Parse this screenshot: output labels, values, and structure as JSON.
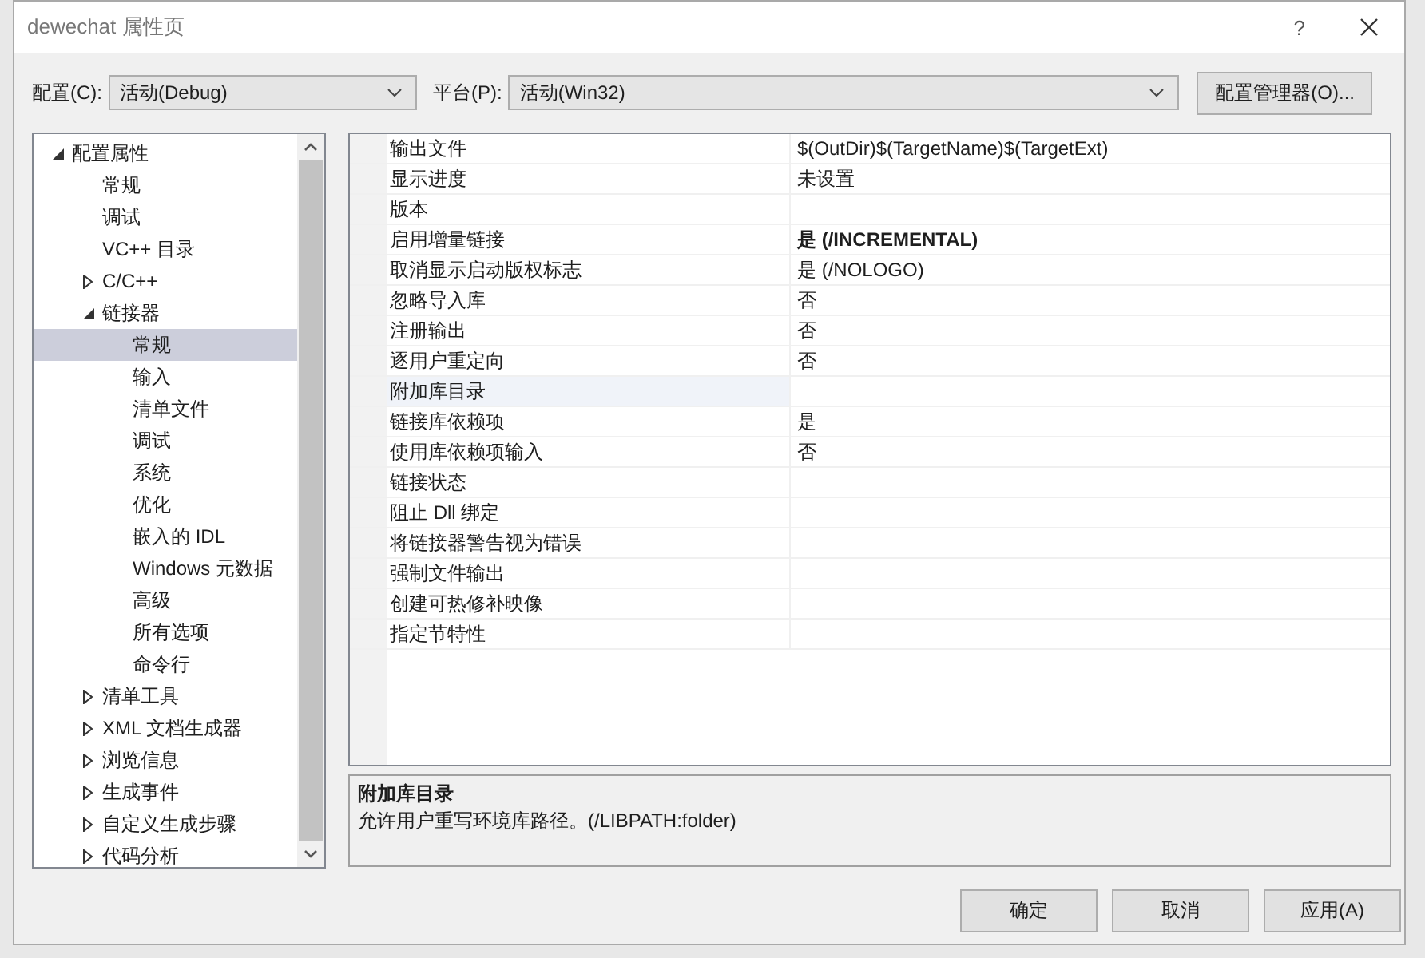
{
  "window": {
    "title": "dewechat 属性页",
    "help": "?"
  },
  "config": {
    "label": "配置(C):",
    "value": "活动(Debug)"
  },
  "platform": {
    "label": "平台(P):",
    "value": "活动(Win32)"
  },
  "config_manager_button": "配置管理器(O)...",
  "tree": [
    {
      "label": "配置属性",
      "expanded": true,
      "selected": false,
      "children": [
        {
          "label": "常规",
          "selected": false
        },
        {
          "label": "调试",
          "selected": false
        },
        {
          "label": "VC++ 目录",
          "selected": false
        },
        {
          "label": "C/C++",
          "expanded": false,
          "selected": false
        },
        {
          "label": "链接器",
          "expanded": true,
          "selected": false,
          "children": [
            {
              "label": "常规",
              "selected": true
            },
            {
              "label": "输入",
              "selected": false
            },
            {
              "label": "清单文件",
              "selected": false
            },
            {
              "label": "调试",
              "selected": false
            },
            {
              "label": "系统",
              "selected": false
            },
            {
              "label": "优化",
              "selected": false
            },
            {
              "label": "嵌入的 IDL",
              "selected": false
            },
            {
              "label": "Windows 元数据",
              "selected": false
            },
            {
              "label": "高级",
              "selected": false
            },
            {
              "label": "所有选项",
              "selected": false
            },
            {
              "label": "命令行",
              "selected": false
            }
          ]
        },
        {
          "label": "清单工具",
          "expanded": false,
          "selected": false
        },
        {
          "label": "XML 文档生成器",
          "expanded": false,
          "selected": false
        },
        {
          "label": "浏览信息",
          "expanded": false,
          "selected": false
        },
        {
          "label": "生成事件",
          "expanded": false,
          "selected": false
        },
        {
          "label": "自定义生成步骤",
          "expanded": false,
          "selected": false
        },
        {
          "label": "代码分析",
          "expanded": false,
          "selected": false
        }
      ]
    }
  ],
  "properties": [
    {
      "name": "输出文件",
      "value": "$(OutDir)$(TargetName)$(TargetExt)",
      "bold": false,
      "selected": false
    },
    {
      "name": "显示进度",
      "value": "未设置",
      "bold": false,
      "selected": false
    },
    {
      "name": "版本",
      "selected": false
    },
    {
      "name": "启用增量链接",
      "value": "是 (/INCREMENTAL)",
      "bold": true,
      "selected": false
    },
    {
      "name": "取消显示启动版权标志",
      "value": "是 (/NOLOGO)",
      "bold": false,
      "selected": false
    },
    {
      "name": "忽略导入库",
      "value": "否",
      "bold": false,
      "selected": false
    },
    {
      "name": "注册输出",
      "value": "否",
      "bold": false,
      "selected": false
    },
    {
      "name": "逐用户重定向",
      "value": "否",
      "bold": false,
      "selected": false
    },
    {
      "name": "附加库目录",
      "selected": true
    },
    {
      "name": "链接库依赖项",
      "value": "是",
      "bold": false,
      "selected": false
    },
    {
      "name": "使用库依赖项输入",
      "value": "否",
      "bold": false,
      "selected": false
    },
    {
      "name": "链接状态",
      "selected": false
    },
    {
      "name": "阻止 Dll 绑定",
      "selected": false
    },
    {
      "name": "将链接器警告视为错误",
      "selected": false
    },
    {
      "name": "强制文件输出",
      "selected": false
    },
    {
      "name": "创建可热修补映像",
      "selected": false
    },
    {
      "name": "指定节特性",
      "selected": false
    }
  ],
  "description": {
    "title": "附加库目录",
    "text": "允许用户重写环境库路径。(/LIBPATH:folder)"
  },
  "buttons": [
    "确定",
    "取消",
    "应用(A)"
  ]
}
